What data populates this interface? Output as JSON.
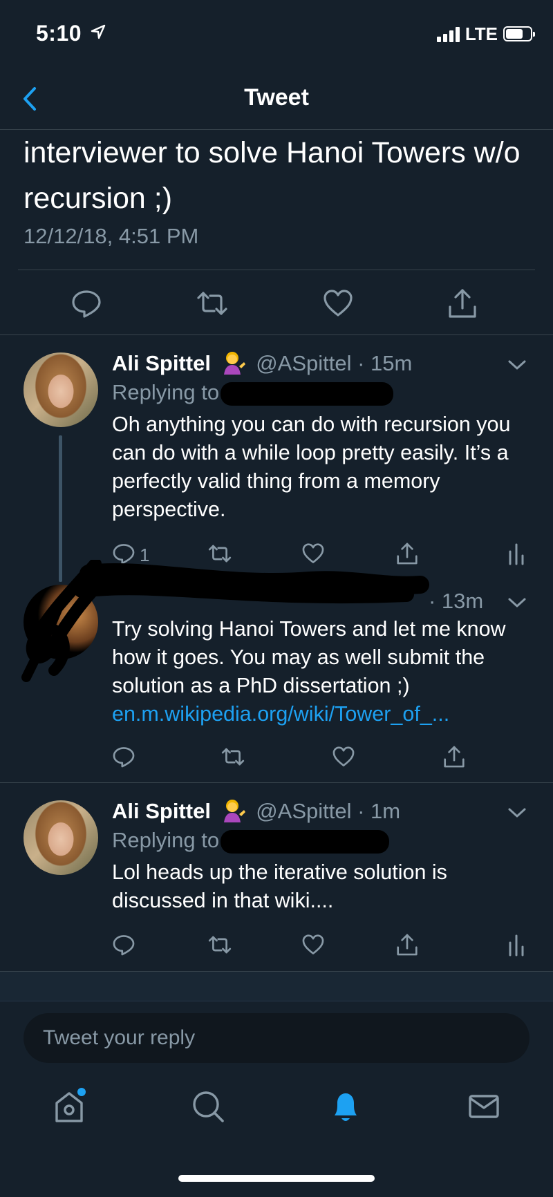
{
  "status_bar": {
    "time": "5:10",
    "network": "LTE"
  },
  "header": {
    "title": "Tweet"
  },
  "main_tweet": {
    "text_line1": "interviewer to solve Hanoi Towers w/o",
    "text_line2": "recursion ;)",
    "timestamp": "12/12/18, 4:51 PM"
  },
  "replies": [
    {
      "display_name": "Ali Spittel",
      "handle_time": "@ASpittel · 15m",
      "replying_label": "Replying to",
      "text": "Oh anything you can do with recursion you can do with a while loop pretty easily. It’s a perfectly valid thing from a memory perspective.",
      "reply_count": "1"
    },
    {
      "handle_time": "· 13m",
      "text": "Try solving Hanoi Towers and let me know how it goes. You may as well submit the solution as a PhD dissertation ;)",
      "link": "en.m.wikipedia.org/wiki/Tower_of_..."
    },
    {
      "display_name": "Ali Spittel",
      "handle_time": "@ASpittel · 1m",
      "replying_label": "Replying to",
      "text": "Lol heads up the iterative solution is discussed in that wiki...."
    }
  ],
  "composer": {
    "placeholder": "Tweet your reply"
  },
  "tabs": [
    "home-icon",
    "search-icon",
    "notifications-bell-icon",
    "messages-mail-icon"
  ],
  "colors": {
    "background": "#15202b",
    "accent": "#1da1f2",
    "secondary_text": "#8899a6",
    "divider": "#38444d"
  }
}
